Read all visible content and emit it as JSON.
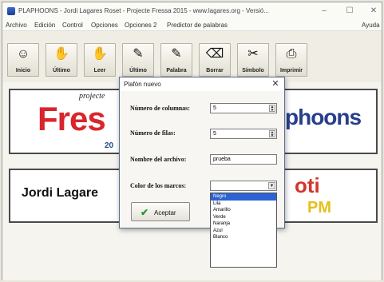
{
  "window": {
    "title": "PLAPHOONS - Jordi Lagares Roset - Projecte Fressa 2015 - www.lagares.org - Versió..."
  },
  "menubar": {
    "items": [
      "Archivo",
      "Edición",
      "Control",
      "Opciones",
      "Opciones 2",
      "Predictor de palabras"
    ],
    "help": "Ayuda"
  },
  "toolbar": {
    "tools": [
      {
        "label": "Inicio",
        "icon": "robot-icon"
      },
      {
        "label": "Último",
        "icon": "clapping-hands-icon"
      },
      {
        "label": "Leer",
        "icon": "clapping-hands-icon"
      },
      {
        "label": "Último",
        "icon": "pencil-icon"
      },
      {
        "label": "Palabra",
        "icon": "pencil-icon"
      },
      {
        "label": "Borrar",
        "icon": "eraser-icon"
      },
      {
        "label": "Símbolo",
        "icon": "scissors-icon"
      },
      {
        "label": "Imprimir",
        "icon": "printer-icon"
      }
    ]
  },
  "banners": {
    "fressa_subtitle": "projecte",
    "fressa_word": "Fres",
    "fressa_year": "20",
    "plaphoons_word": "phoons",
    "author_word": "Jordi Lagare",
    "oti_word": "oti",
    "pm_word": "PM"
  },
  "dialog": {
    "title": "Plafón nuevo",
    "columns_label": "Número de columnas:",
    "columns_value": "5",
    "rows_label": "Número de filas:",
    "rows_value": "5",
    "filename_label": "Nombre del archivo:",
    "filename_value": "prueba",
    "color_label": "Color de los marcos:",
    "color_options": [
      "Negro",
      "Lila",
      "Amarillo",
      "Verde",
      "Naranja",
      "Azul",
      "Blanco"
    ],
    "selected_color_index": 0,
    "ok_label": "Aceptar"
  },
  "colors": {
    "selection": "#2c63d3",
    "fressa_red": "#d8262c",
    "plaphoons_blue": "#283f8c",
    "pm_yellow": "#e5c01a"
  }
}
